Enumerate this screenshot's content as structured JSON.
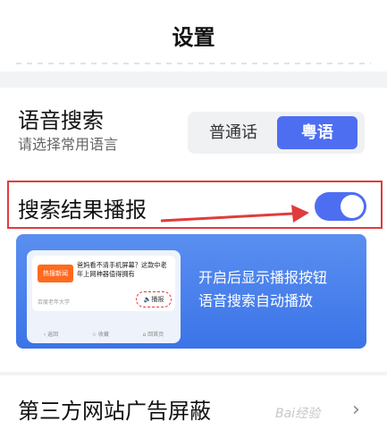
{
  "header": {
    "title": "设置"
  },
  "voice_search": {
    "title": "语音搜索",
    "subtitle": "请选择常用语言",
    "options": [
      "普通话",
      "粤语"
    ],
    "selected": "粤语"
  },
  "broadcast": {
    "label": "搜索结果播报",
    "enabled": true
  },
  "banner": {
    "tag": "热搜新闻",
    "news_text": "爸妈看不清手机屏幕？这款中老年上网神器值得拥有",
    "source": "百度老年大学",
    "play_label": "播报",
    "nav": [
      "返回",
      "收藏",
      "回首页"
    ],
    "description_line1": "开启后显示播报按钮",
    "description_line2": "语音搜索自动播放"
  },
  "third_party": {
    "label": "第三方网站广告屏蔽"
  },
  "watermark": "Bai经验"
}
